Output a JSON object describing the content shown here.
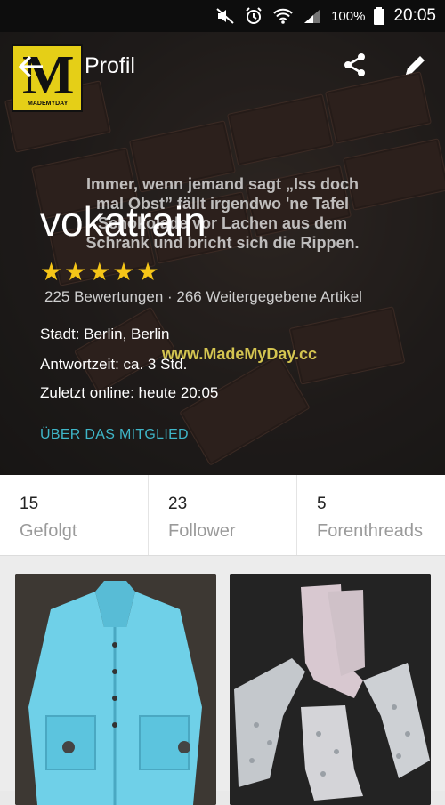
{
  "status_bar": {
    "battery": "100%",
    "time": "20:05"
  },
  "app_bar": {
    "title": "Profil",
    "logo_letter": "M",
    "logo_text": "MADEMYDAY"
  },
  "cover_image": {
    "quote": "Immer, wenn jemand sagt „Iss doch mal Obst” fällt irgendwo 'ne Tafel Schokolade vor Lachen aus dem Schrank und bricht sich die Rippen.",
    "url": "www.MadeMyDay.cc"
  },
  "profile": {
    "username": "vokatrain",
    "rating_stars": 5,
    "ratings_line": "225 Bewertungen · 266 Weitergegebene Artikel",
    "city": "Stadt: Berlin, Berlin",
    "response_time": "Antwortzeit:  ca. 3 Std.",
    "last_online": "Zuletzt online: heute 20:05",
    "about_link": "ÜBER DAS MITGLIED"
  },
  "stats": [
    {
      "count": "15",
      "label": "Gefolgt"
    },
    {
      "count": "23",
      "label": "Follower"
    },
    {
      "count": "5",
      "label": "Forenthreads"
    }
  ],
  "listings": [
    {
      "name": "light-blue-girls-coat"
    },
    {
      "name": "patterned-socks"
    }
  ],
  "colors": {
    "accent": "#3fb6c8",
    "star": "#f5c518",
    "logo": "#e5cf17"
  }
}
